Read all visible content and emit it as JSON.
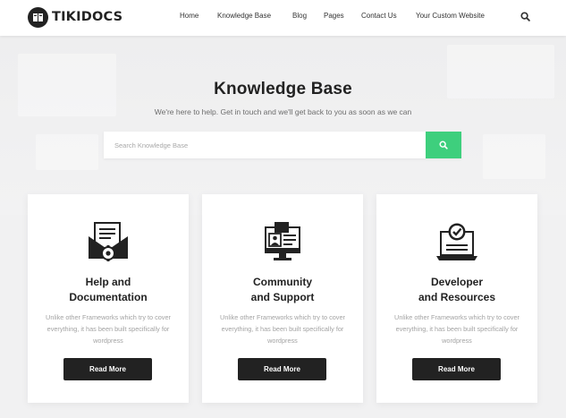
{
  "header": {
    "logo_text": "TIKIDOCS",
    "nav": [
      {
        "label": "Home"
      },
      {
        "label": "Knowledge Base"
      },
      {
        "label": "Blog"
      },
      {
        "label": "Pages"
      },
      {
        "label": "Contact Us"
      },
      {
        "label": "Your Custom Website"
      }
    ],
    "search_icon": "search-icon"
  },
  "hero": {
    "title": "Knowledge Base",
    "subtitle": "We're here to help. Get in touch and we'll get back to you as soon as we can",
    "search": {
      "placeholder": "Search Knowledge Base",
      "value": "",
      "button_icon": "search-icon"
    }
  },
  "cards": [
    {
      "icon": "envelope-gear-icon",
      "title_line1": "Help and",
      "title_line2": "Documentation",
      "description": "Unlike other Frameworks which try to cover everything, it has been built specifically for wordpress",
      "button": "Read More"
    },
    {
      "icon": "monitor-profile-icon",
      "title_line1": "Community",
      "title_line2": "and Support",
      "description": "Unlike other Frameworks which try to cover everything, it has been built specifically for wordpress",
      "button": "Read More"
    },
    {
      "icon": "laptop-check-icon",
      "title_line1": "Developer",
      "title_line2": "and Resources",
      "description": "Unlike other Frameworks which try to cover everything, it has been built specifically for wordpress",
      "button": "Read More"
    }
  ],
  "colors": {
    "accent": "#3ecf7d",
    "dark": "#222222",
    "background": "#f1f1f2"
  }
}
